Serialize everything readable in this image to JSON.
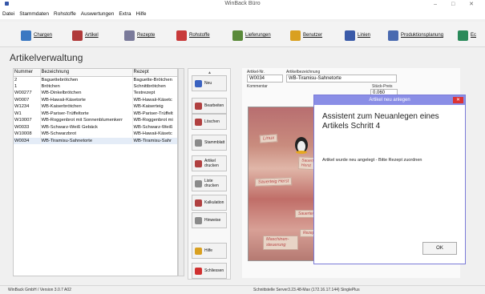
{
  "window": {
    "title": "WinBack Büro",
    "controls": "– □ ✕"
  },
  "menu": [
    "Datei",
    "Stammdaten",
    "Rohstoffe",
    "Auswertungen",
    "Extra",
    "Hilfe"
  ],
  "toolbar": [
    {
      "label": "Chargen",
      "icon": "chargen-icon",
      "color": "#3b78c2"
    },
    {
      "label": "Artikel",
      "icon": "artikel-icon",
      "color": "#b03a3a"
    },
    {
      "label": "Rezepte",
      "icon": "rezepte-icon",
      "color": "#7a7a9a"
    },
    {
      "label": "Rohstoffe",
      "icon": "rohstoffe-icon",
      "color": "#c83a3a"
    },
    {
      "label": "Lieferungen",
      "icon": "lieferungen-icon",
      "color": "#5a8a3a"
    },
    {
      "label": "Benutzer",
      "icon": "benutzer-icon",
      "color": "#d9a020"
    },
    {
      "label": "Linien",
      "icon": "linien-icon",
      "color": "#3a5aa8"
    },
    {
      "label": "Produktionsplanung",
      "icon": "produktionsplanung-icon",
      "color": "#4a6ab0"
    },
    {
      "label": "Ec",
      "icon": "ec-icon",
      "color": "#2a8a5a"
    }
  ],
  "page_title": "Artikelverwaltung",
  "table": {
    "headers": [
      "Nummer",
      "Bezeichnung",
      "Rezept"
    ],
    "rows": [
      [
        "2",
        "Baguettebrötchen",
        "Baguette-Brötchen"
      ],
      [
        "1",
        "Brötchen",
        "Schnittbrötchen"
      ],
      [
        "W00277",
        "WB-Dinkelbrötchen",
        "Testrezept"
      ],
      [
        "W0007",
        "WB-Hawaii-Käsetorte",
        "WB-Hawaii-Käsetc"
      ],
      [
        "W1234",
        "WB-Kaiserbrötchen",
        "WB-Kaiserteig"
      ],
      [
        "W1",
        "WB-Pariser-Trüffeltorte",
        "WB-Pariser-Trüffelt"
      ],
      [
        "W10007",
        "WB-Roggenbrot mit Sonnenblumenkerr",
        "WB-Roggenbrot mi"
      ],
      [
        "W0033",
        "WB-Schwarz-Weiß Gebäck",
        "WB-Schwarz-Weiß"
      ],
      [
        "W10008",
        "WB-Schwarzbrot",
        "WB-Hawaii-Käsetc"
      ],
      [
        "W0034",
        "WB-Tiramisu-Sahnetorte",
        "WB-Tiramisu-Sahr"
      ]
    ]
  },
  "actions": [
    {
      "label": "Neu",
      "icon": "new-icon",
      "color": "#3a62c0"
    },
    {
      "label": "Bearbeiten",
      "icon": "edit-icon",
      "color": "#b04040"
    },
    {
      "label": "Löschen",
      "icon": "delete-icon",
      "color": "#b04040"
    },
    {
      "label": "Stammblatt",
      "icon": "stammblatt-icon",
      "color": "#8a8a8a"
    },
    {
      "label": "Artikel drucken",
      "icon": "print-article-icon",
      "color": "#b04040"
    },
    {
      "label": "Liste drucken",
      "icon": "print-list-icon",
      "color": "#8a8a8a"
    },
    {
      "label": "Kalkulation",
      "icon": "calculation-icon",
      "color": "#b04040"
    },
    {
      "label": "Hinweise",
      "icon": "notes-icon",
      "color": "#8a8a8a"
    },
    {
      "label": "Hilfe",
      "icon": "help-icon",
      "color": "#d9a020"
    },
    {
      "label": "Schliessen",
      "icon": "close-x-icon",
      "color": "#d03030"
    }
  ],
  "detail": {
    "artnr_label": "Artikel-Nr.",
    "artnr_value": "W0034",
    "bez_label": "Artikelbezeichnung",
    "bez_value": "WB-Tiramisu-Sahnetorte",
    "kommentar_label": "Kommentar",
    "stueckpreis_label": "Stück-Preis",
    "stueckpreis_value": "0.060"
  },
  "photo_cards": [
    "Linux",
    "Sauerteig-Herst",
    "Sauerteig Herst",
    "Sauerteig",
    "Rezepte",
    "Maschinen-steuerung"
  ],
  "dialog": {
    "title": "Artikel neu anlegen",
    "close": "✕",
    "heading": "Assistent zum Neuanlegen eines Artikels Schritt 4",
    "message": "Artikel wurde neu angelegt - Bitte Rezept zuordnen",
    "ok": "OK"
  },
  "status": {
    "left": "WinBack GmbH /  Version 3.0.7 A02",
    "right": "Schnittstelle Server3.23.48-Max (172.16.17.144) SinglePlus"
  }
}
